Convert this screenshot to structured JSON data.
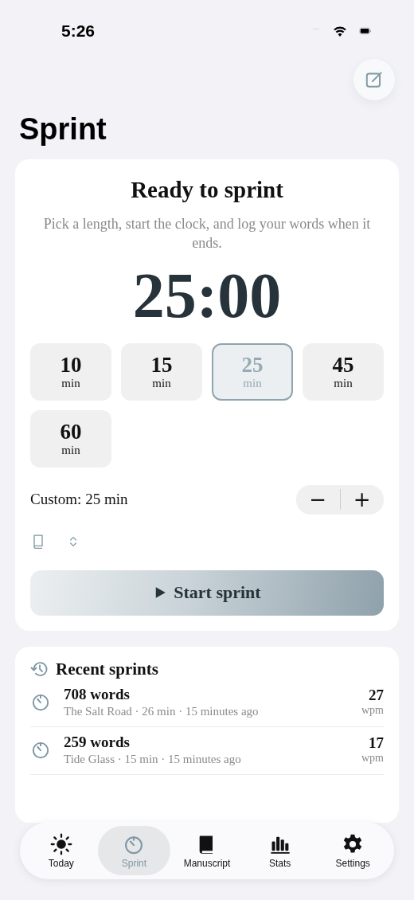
{
  "status_bar": {
    "time": "5:26"
  },
  "title": "Sprint",
  "sprint_card": {
    "heading": "Ready to sprint",
    "subtitle": "Pick a length, start the clock, and log your words when it ends.",
    "timer": "25:00",
    "presets": [
      {
        "value": "10",
        "unit": "min",
        "selected": false
      },
      {
        "value": "15",
        "unit": "min",
        "selected": false
      },
      {
        "value": "25",
        "unit": "min",
        "selected": true
      },
      {
        "value": "45",
        "unit": "min",
        "selected": false
      },
      {
        "value": "60",
        "unit": "min",
        "selected": false
      }
    ],
    "custom_label": "Custom: 25 min",
    "decrement": "−",
    "increment": "+",
    "start_button": "Start sprint"
  },
  "recent": {
    "heading": "Recent sprints",
    "items": [
      {
        "words": "708 words",
        "detail": "The Salt Road · 26 min · 15 minutes ago",
        "rate": "27",
        "rate_unit": "wpm"
      },
      {
        "words": "259 words",
        "detail": "Tide Glass · 15 min · 15 minutes ago",
        "rate": "17",
        "rate_unit": "wpm"
      }
    ]
  },
  "tabs": [
    {
      "kind": "sun",
      "label": "Today",
      "selected": false
    },
    {
      "kind": "timer",
      "label": "Sprint",
      "selected": true
    },
    {
      "kind": "book",
      "label": "Manuscript",
      "selected": false
    },
    {
      "kind": "chart",
      "label": "Stats",
      "selected": false
    },
    {
      "kind": "gear",
      "label": "Settings",
      "selected": false
    }
  ]
}
